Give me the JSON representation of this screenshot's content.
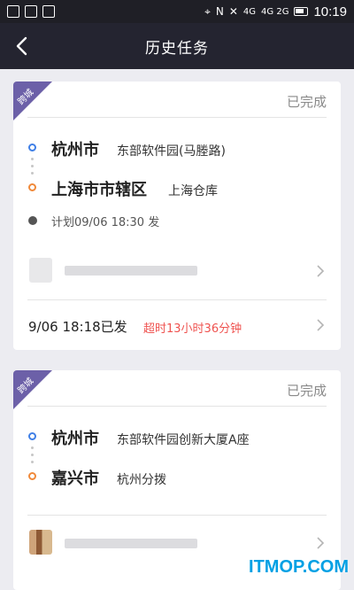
{
  "statusbar": {
    "network_top": "4G",
    "network_bottom": "4G 2G",
    "battery_label": "",
    "time": "10:19"
  },
  "navbar": {
    "title": "历史任务"
  },
  "tasks": [
    {
      "tag": "跨城",
      "status": "已完成",
      "origin_city": "杭州市",
      "origin_place": "东部软件园(马塍路)",
      "dest_city": "上海市市辖区",
      "dest_place": "上海仓库",
      "plan_time": "计划09/06 18:30 发",
      "sent_time": "9/06 18:18已发",
      "overtime": "超时13小时36分钟"
    },
    {
      "tag": "跨城",
      "status": "已完成",
      "origin_city": "杭州市",
      "origin_place": "东部软件园创新大厦A座",
      "dest_city": "嘉兴市",
      "dest_place": "杭州分拨"
    }
  ],
  "icons": {
    "back": "back-arrow-icon",
    "clock": "clock-icon",
    "chevron": "chevron-right-icon"
  },
  "colors": {
    "header": "#242430",
    "ribbon": "#6c60a8",
    "origin": "#3f7fe6",
    "destination": "#f0893a",
    "overtime": "#ef5350",
    "watermark": "#00a0e4"
  },
  "watermark": "ITMOP.COM"
}
